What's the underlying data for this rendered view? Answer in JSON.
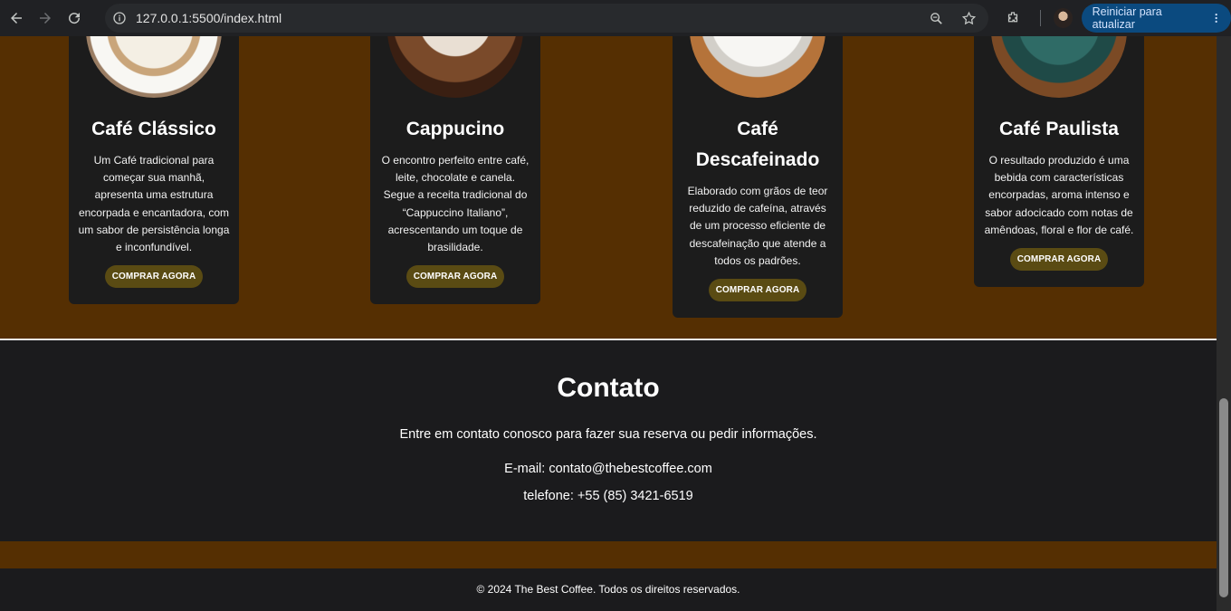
{
  "browser": {
    "url": "127.0.0.1:5500/index.html",
    "update_label": "Reiniciar para atualizar"
  },
  "products": [
    {
      "name": "Café Clássico",
      "description": "Um Café tradicional para começar sua manhã, apresenta uma estrutura encorpada e encantadora, com um sabor de persistência longa e inconfundível.",
      "button": "COMPRAR AGORA"
    },
    {
      "name": "Cappucino",
      "description": "O encontro perfeito entre café, leite, chocolate e canela. Segue a receita tradicional do “Cappuccino Italiano”, acrescentando um toque de brasilidade.",
      "button": "COMPRAR AGORA"
    },
    {
      "name": "Café Descafeinado",
      "description": "Elaborado com grãos de teor reduzido de cafeína, através de um processo eficiente de descafeinação que atende a todos os padrões.",
      "button": "COMPRAR AGORA"
    },
    {
      "name": "Café Paulista",
      "description": "O resultado produzido é uma bebida com características encorpadas, aroma intenso e sabor adocicado com notas de amêndoas, floral e flor de café.",
      "button": "COMPRAR AGORA"
    }
  ],
  "contact": {
    "title": "Contato",
    "lead": "Entre em contato conosco para fazer sua reserva ou pedir informações.",
    "email": "E-mail: contato@thebestcoffee.com",
    "phone": "telefone: +55 (85) 3421-6519"
  },
  "footer": {
    "text": "© 2024 The Best Coffee. Todos os direitos reservados."
  },
  "colors": {
    "brown": "#552f02",
    "dark": "#1b1b1d",
    "button": "#5a4b13"
  }
}
